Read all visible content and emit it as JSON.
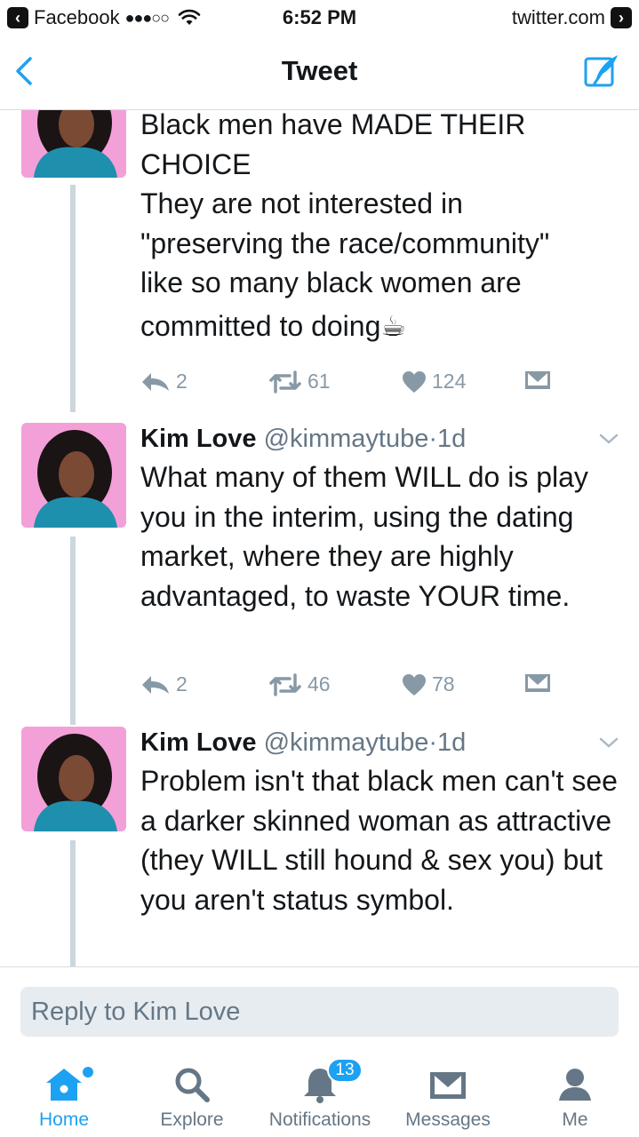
{
  "status_bar": {
    "back_app": "Facebook",
    "signal": "●●●○○",
    "time": "6:52 PM",
    "domain": "twitter.com"
  },
  "nav": {
    "title": "Tweet"
  },
  "tweets": [
    {
      "text_lines": [
        "Black men have MADE THEIR",
        "CHOICE",
        "They are not interested in",
        "\"preserving the race/community\"",
        "like so many black women are",
        "committed to doing☕"
      ],
      "replies": "2",
      "retweets": "61",
      "likes": "124"
    },
    {
      "name": "Kim Love",
      "handle": "@kimmaytube",
      "dot": "·",
      "time": "1d",
      "text": "What many of them WILL do is play you in the interim, using the dating market, where they are highly advantaged, to waste YOUR time.",
      "replies": "2",
      "retweets": "46",
      "likes": "78"
    },
    {
      "name": "Kim Love",
      "handle": "@kimmaytube",
      "dot": "·",
      "time": "1d",
      "text": "Problem isn't that black men can't see a darker skinned woman as attractive (they WILL still hound & sex you) but you aren't status symbol."
    }
  ],
  "reply": {
    "placeholder": "Reply to Kim Love"
  },
  "tabs": [
    {
      "label": "Home",
      "icon": "home-icon",
      "active": true
    },
    {
      "label": "Explore",
      "icon": "search-icon"
    },
    {
      "label": "Notifications",
      "icon": "bell-icon",
      "badge": "13"
    },
    {
      "label": "Messages",
      "icon": "envelope-icon"
    },
    {
      "label": "Me",
      "icon": "person-icon"
    }
  ],
  "colors": {
    "accent": "#1da1f2",
    "text": "#14171a",
    "muted": "#657786",
    "action_gray": "#8899a6",
    "thread_line": "#ccd6dd",
    "avatar_bg": "#f3a0d8"
  }
}
